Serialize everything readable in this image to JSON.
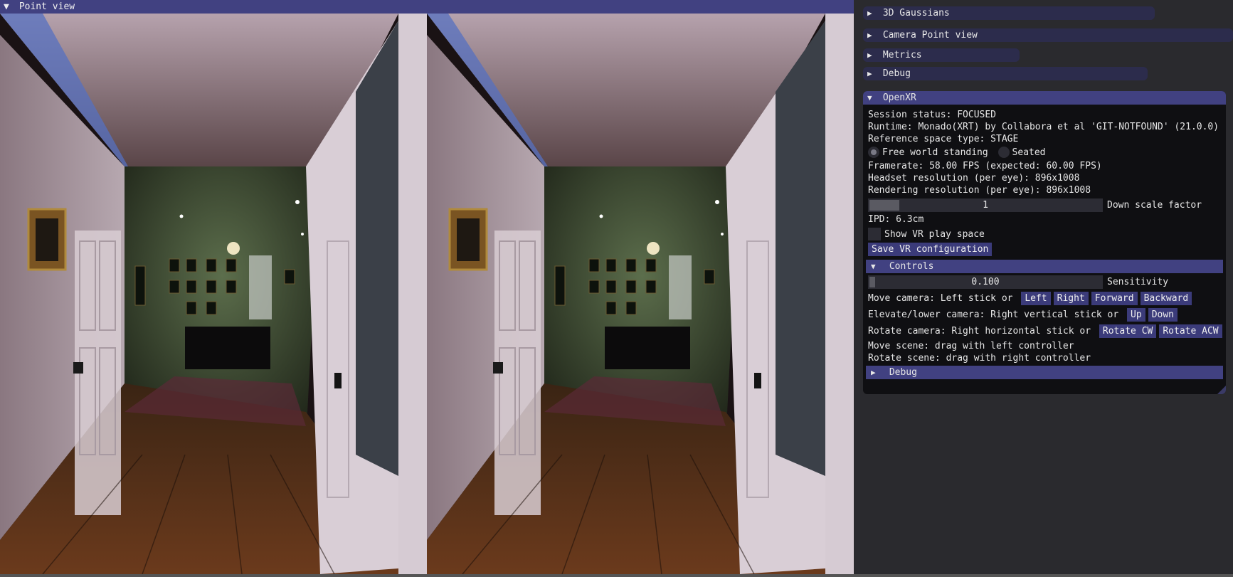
{
  "point_view": {
    "title": "Point view",
    "arrow": "▼"
  },
  "side_headers": [
    {
      "label": "3D Gaussians",
      "arrow": "▶"
    },
    {
      "label": "Camera Point view",
      "arrow": "▶"
    },
    {
      "label": "Metrics",
      "arrow": "▶"
    },
    {
      "label": "Debug",
      "arrow": "▶"
    }
  ],
  "openxr": {
    "title": "OpenXR",
    "arrow": "▼",
    "session_status": "Session status: FOCUSED",
    "runtime": "Runtime: Monado(XRT) by Collabora et al 'GIT-NOTFOUND' (21.0.0)",
    "reference_space": "Reference space type: STAGE",
    "radio_free": "Free world standing",
    "radio_seated": "Seated",
    "radio_selected": "free",
    "framerate": "Framerate: 58.00 FPS (expected: 60.00 FPS)",
    "headset_res": "Headset resolution (per eye): 896x1008",
    "render_res": "Rendering resolution (per eye): 896x1008",
    "downscale_value": "1",
    "downscale_label": "Down scale factor",
    "downscale_fraction": 0.1,
    "ipd": "IPD: 6.3cm",
    "show_play_space": "Show VR play space",
    "save_button": "Save VR configuration",
    "controls": {
      "title": "Controls",
      "arrow": "▼",
      "sensitivity_value": "0.100",
      "sensitivity_label": "Sensitivity",
      "sensitivity_fraction": 0.02,
      "move_camera": "Move camera: Left stick or",
      "move_buttons": [
        "Left",
        "Right",
        "Forward",
        "Backward"
      ],
      "elevate_camera": "Elevate/lower camera: Right vertical stick or",
      "elevate_buttons": [
        "Up",
        "Down"
      ],
      "rotate_camera": "Rotate camera: Right horizontal stick or",
      "rotate_buttons": [
        "Rotate CW",
        "Rotate ACW"
      ],
      "move_scene": "Move scene: drag with left controller",
      "rotate_scene": "Rotate scene: drag with right controller"
    },
    "debug": {
      "title": "Debug",
      "arrow": "▶"
    }
  }
}
